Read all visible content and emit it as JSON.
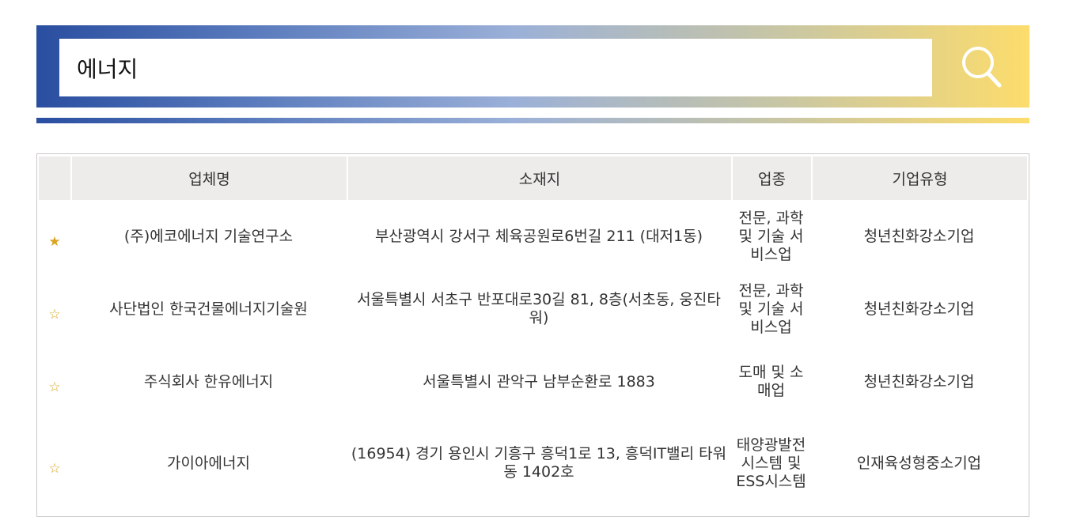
{
  "search": {
    "value": "에너지",
    "icon": "search-icon"
  },
  "table": {
    "headers": [
      "",
      "업체명",
      "소재지",
      "업종",
      "기업유형"
    ],
    "rows": [
      {
        "star": "★",
        "starred": true,
        "name": "(주)에코에너지 기술연구소",
        "address": "부산광역시 강서구 체육공원로6번길 211 (대저1동)",
        "industry": "전문, 과학 및 기술 서비스업",
        "type": "청년친화강소기업"
      },
      {
        "star": "☆",
        "starred": false,
        "name": "사단법인 한국건물에너지기술원",
        "address": "서울특별시 서초구 반포대로30길 81, 8층(서초동, 웅진타워)",
        "industry": "전문, 과학 및 기술 서비스업",
        "type": "청년친화강소기업"
      },
      {
        "star": "☆",
        "starred": false,
        "name": "주식회사 한유에너지",
        "address": "서울특별시 관악구 남부순환로 1883",
        "industry": "도매 및 소매업",
        "type": "청년친화강소기업"
      },
      {
        "star": "☆",
        "starred": false,
        "name": "가이아에너지",
        "address": "(16954) 경기 용인시 기흥구 흥덕1로 13, 흥덕IT밸리 타워동 1402호",
        "industry": "태양광발전시스템 및 ESS시스템",
        "type": "인재육성형중소기업"
      }
    ]
  },
  "colors": {
    "gradient_start": "#2a4ea0",
    "gradient_end": "#fcdc6c",
    "header_bg": "#edecea",
    "star": "#d9a520"
  }
}
